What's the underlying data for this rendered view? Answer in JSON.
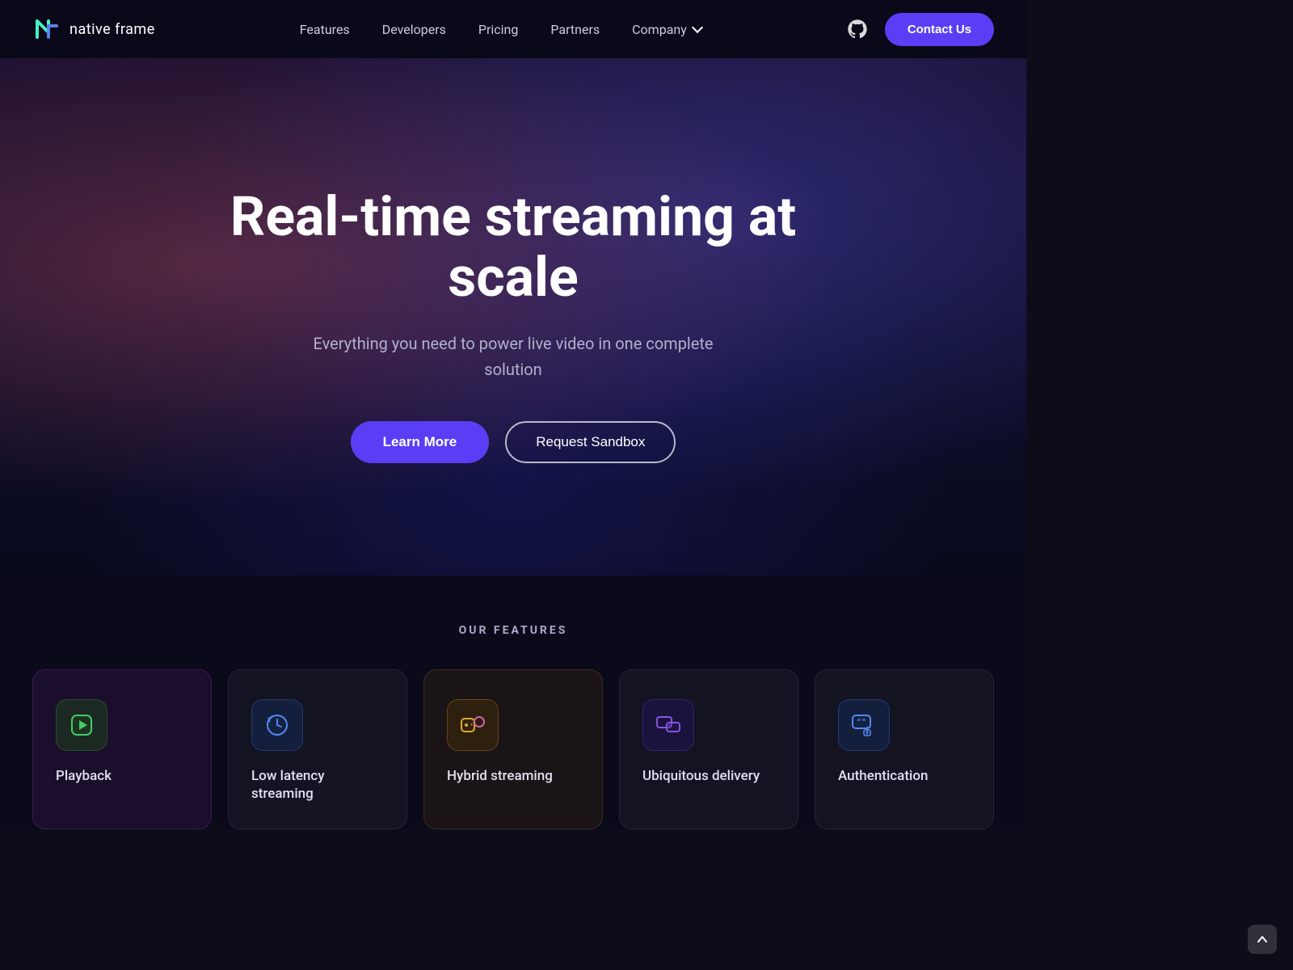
{
  "brand": {
    "logo_text": "native frame",
    "logo_alt": "Native Frame logo"
  },
  "navbar": {
    "links": [
      {
        "label": "Features",
        "id": "features"
      },
      {
        "label": "Developers",
        "id": "developers"
      },
      {
        "label": "Pricing",
        "id": "pricing"
      },
      {
        "label": "Partners",
        "id": "partners"
      },
      {
        "label": "Company",
        "id": "company",
        "has_dropdown": true
      }
    ],
    "github_label": "GitHub",
    "cta_label": "Contact Us"
  },
  "hero": {
    "title": "Real-time streaming at scale",
    "subtitle": "Everything you need to power live video in one complete solution",
    "btn_primary": "Learn More",
    "btn_secondary": "Request Sandbox"
  },
  "features": {
    "section_label": "OUR FEATURES",
    "items": [
      {
        "id": "playback",
        "name": "Playback",
        "icon": "playback-icon"
      },
      {
        "id": "low-latency-streaming",
        "name": "Low latency streaming",
        "icon": "clock-icon"
      },
      {
        "id": "hybrid-streaming",
        "name": "Hybrid streaming",
        "icon": "hybrid-icon"
      },
      {
        "id": "ubiquitous-delivery",
        "name": "Ubiquitous delivery",
        "icon": "delivery-icon"
      },
      {
        "id": "authentication",
        "name": "Authentication",
        "icon": "auth-icon"
      }
    ]
  },
  "scroll": {
    "up_label": "Scroll up"
  }
}
